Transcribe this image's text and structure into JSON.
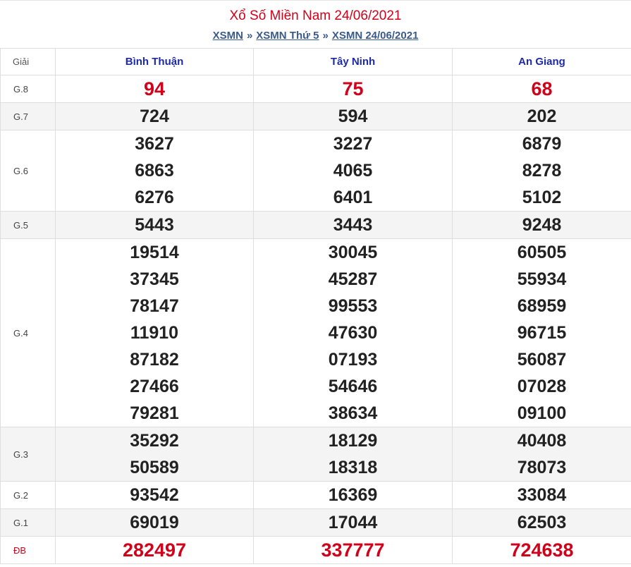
{
  "title": "Xổ Số Miền Nam 24/06/2021",
  "breadcrumb": [
    {
      "label": "XSMN"
    },
    {
      "label": "XSMN Thứ 5"
    },
    {
      "label": "XSMN 24/06/2021"
    }
  ],
  "breadcrumb_sep": "»",
  "table": {
    "header_label": "Giải",
    "provinces": [
      "Bình Thuận",
      "Tây Ninh",
      "An Giang"
    ],
    "rows": [
      {
        "label": "G.8",
        "values": [
          [
            "94"
          ],
          [
            "75"
          ],
          [
            "68"
          ]
        ]
      },
      {
        "label": "G.7",
        "values": [
          [
            "724"
          ],
          [
            "594"
          ],
          [
            "202"
          ]
        ]
      },
      {
        "label": "G.6",
        "values": [
          [
            "3627",
            "6863",
            "6276"
          ],
          [
            "3227",
            "4065",
            "6401"
          ],
          [
            "6879",
            "8278",
            "5102"
          ]
        ]
      },
      {
        "label": "G.5",
        "values": [
          [
            "5443"
          ],
          [
            "3443"
          ],
          [
            "9248"
          ]
        ]
      },
      {
        "label": "G.4",
        "values": [
          [
            "19514",
            "37345",
            "78147",
            "11910",
            "87182",
            "27466",
            "79281"
          ],
          [
            "30045",
            "45287",
            "99553",
            "47630",
            "07193",
            "54646",
            "38634"
          ],
          [
            "60505",
            "55934",
            "68959",
            "96715",
            "56087",
            "07028",
            "09100"
          ]
        ]
      },
      {
        "label": "G.3",
        "values": [
          [
            "35292",
            "50589"
          ],
          [
            "18129",
            "18318"
          ],
          [
            "40408",
            "78073"
          ]
        ]
      },
      {
        "label": "G.2",
        "values": [
          [
            "93542"
          ],
          [
            "16369"
          ],
          [
            "33084"
          ]
        ]
      },
      {
        "label": "G.1",
        "values": [
          [
            "69019"
          ],
          [
            "17044"
          ],
          [
            "62503"
          ]
        ]
      },
      {
        "label": "ĐB",
        "values": [
          [
            "282497"
          ],
          [
            "337777"
          ],
          [
            "724638"
          ]
        ]
      }
    ]
  },
  "colors": {
    "accent_red": "#d0021b",
    "province_blue": "#1d2aa8",
    "link_blue": "#3a5a8c"
  }
}
